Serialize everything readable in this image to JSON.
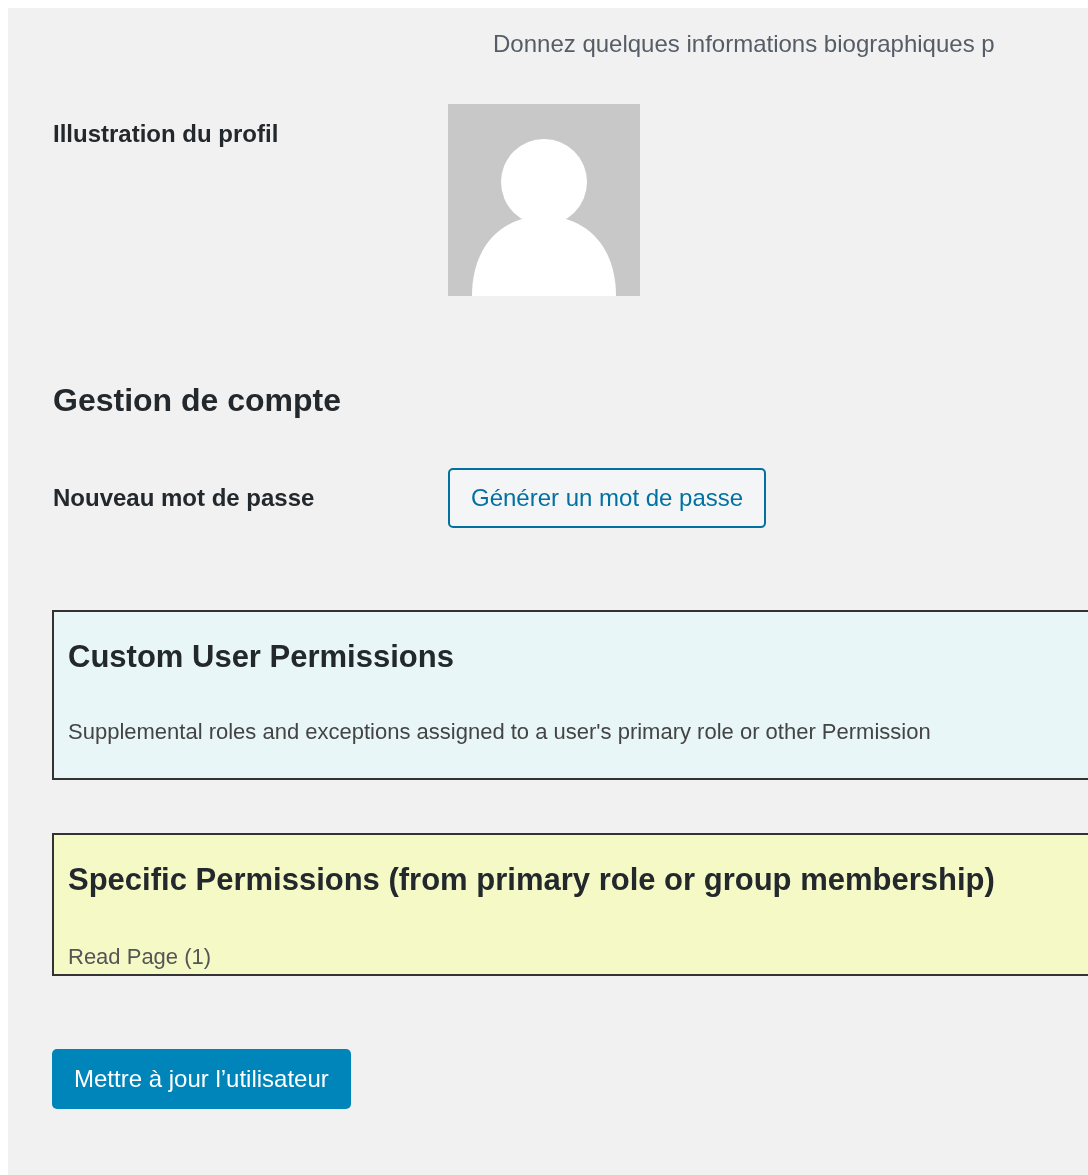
{
  "bio_hint": "Donnez quelques informations biographiques p",
  "profile_picture": {
    "label": "Illustration du profil"
  },
  "account_section": {
    "heading": "Gestion de compte",
    "password_label": "Nouveau mot de passe",
    "generate_button": "Générer un mot de passe"
  },
  "permission_panels": [
    {
      "kind": "custom",
      "title": "Custom User Permissions",
      "description": "Supplemental roles and exceptions assigned to a user's primary role or other Permission"
    },
    {
      "kind": "specific",
      "title": "Specific Permissions (from primary role or group membership)",
      "items": [
        "Read Page (1)"
      ]
    }
  ],
  "submit_button": "Mettre à jour l’utilisateur"
}
